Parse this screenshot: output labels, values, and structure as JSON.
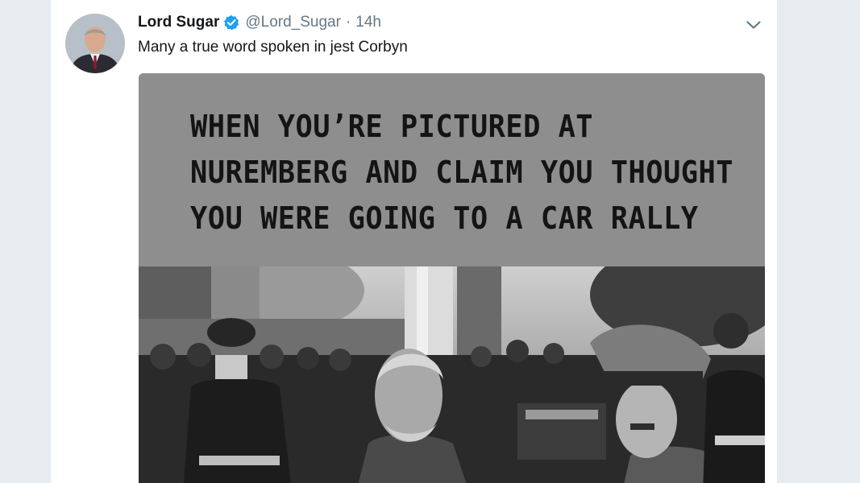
{
  "tweet": {
    "display_name": "Lord Sugar",
    "handle": "@Lord_Sugar",
    "separator": "·",
    "time": "14h",
    "text": "Many a true word spoken in jest Corbyn",
    "verified_icon": "verified-badge-icon",
    "menu_icon": "chevron-down-icon"
  },
  "media": {
    "caption_lines": [
      "WHEN YOU’RE PICTURED AT",
      "NUREMBERG AND CLAIM YOU THOUGHT",
      "YOU WERE GOING TO A CAR RALLY"
    ],
    "photo_style": "black-and-white"
  },
  "colors": {
    "page_background": "#e6ecf0",
    "card_background": "#ffffff",
    "verified_blue": "#1da1f2",
    "secondary_text": "#657786",
    "caption_panel": "#8e8e8e"
  }
}
